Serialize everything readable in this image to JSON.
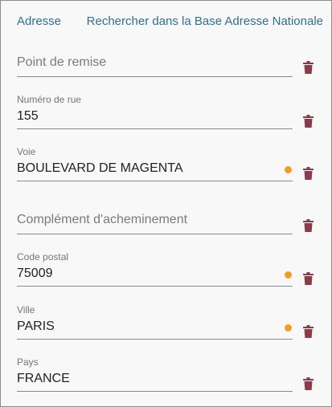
{
  "header": {
    "title": "Adresse",
    "ban_link": "Rechercher dans la Base Adresse Nationale"
  },
  "fields": {
    "point_de_remise": {
      "placeholder": "Point de remise"
    },
    "numero_de_rue": {
      "label": "Numéro de rue",
      "value": "155"
    },
    "voie": {
      "label": "Voie",
      "value": "BOULEVARD DE MAGENTA",
      "warning": true
    },
    "complement": {
      "placeholder": "Complément d'acheminement"
    },
    "code_postal": {
      "label": "Code postal",
      "value": "75009",
      "warning": true
    },
    "ville": {
      "label": "Ville",
      "value": "PARIS",
      "warning": true
    },
    "pays": {
      "label": "Pays",
      "value": "FRANCE"
    }
  },
  "colors": {
    "link": "#2f6f9a",
    "warning_dot": "#f39c1f",
    "delete_icon": "#8b3a4a"
  },
  "icons": {
    "delete": "trash-icon",
    "warning": "warning-dot-icon"
  }
}
